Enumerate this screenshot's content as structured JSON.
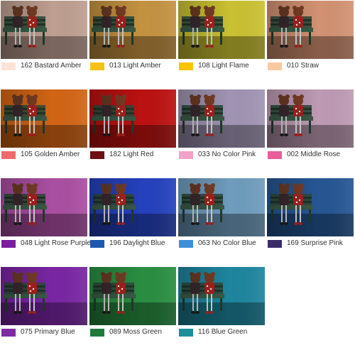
{
  "filters": [
    {
      "label": "162  Bastard Amber",
      "swatch": "#fbe3d6",
      "tint": "#d9b5a6"
    },
    {
      "label": "013  Light Amber",
      "swatch": "#f6c21a",
      "tint": "#e0a84a"
    },
    {
      "label": "108  Light Flame",
      "swatch": "#fbc400",
      "tint": "#e6dc3a"
    },
    {
      "label": "010  Straw",
      "swatch": "#f9c8a1",
      "tint": "#f0a783"
    },
    {
      "label": "105  Golden Amber",
      "swatch": "#ef6a6a",
      "tint": "#f07418"
    },
    {
      "label": "182  Light Red",
      "swatch": "#6d0f14",
      "tint": "#d61414"
    },
    {
      "label": "033  No Color Pink",
      "swatch": "#f2a1c8",
      "tint": "#b7a9cc"
    },
    {
      "label": "002  Middle Rose",
      "swatch": "#e85d9b",
      "tint": "#d9b0cd"
    },
    {
      "label": "048  Light Rose Purple",
      "swatch": "#7a1ea0",
      "tint": "#c25ab9"
    },
    {
      "label": "196  Daylight Blue",
      "swatch": "#1f58b0",
      "tint": "#2b4bd8"
    },
    {
      "label": "063  No Color Blue",
      "swatch": "#3e8fd8",
      "tint": "#7fb2d8"
    },
    {
      "label": "169  Surprise Pink",
      "swatch": "#3a2c68",
      "tint": "#2c62a8"
    },
    {
      "label": "075  Primary Blue",
      "swatch": "#7d2ba3",
      "tint": "#8a2cba"
    },
    {
      "label": "089  Moss Green",
      "swatch": "#1f7a3a",
      "tint": "#2fa24a"
    },
    {
      "label": "116  Blue Green",
      "swatch": "#1c8e9a",
      "tint": "#2398b4"
    }
  ]
}
